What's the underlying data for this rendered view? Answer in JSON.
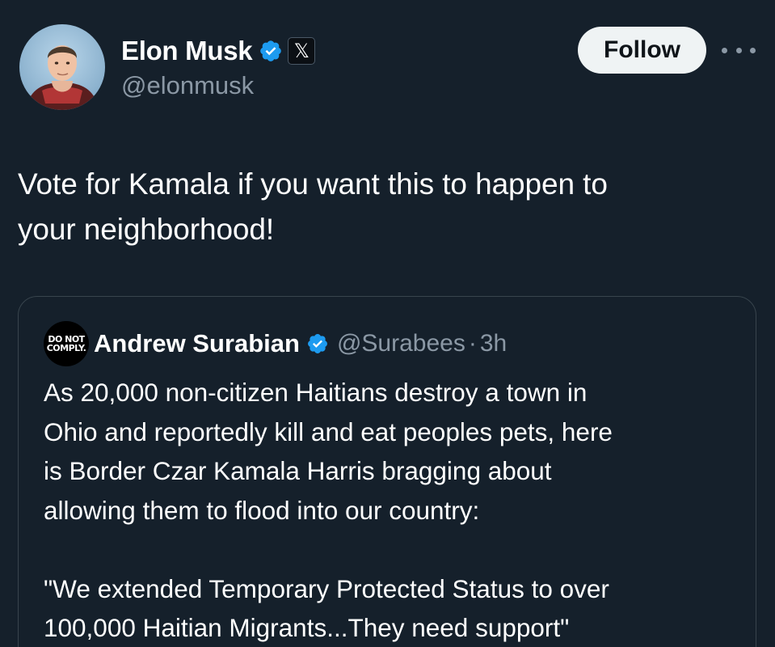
{
  "post": {
    "author": {
      "name": "Elon Musk",
      "handle": "@elonmusk",
      "verified_icon": "verified-badge-icon",
      "affiliation_icon": "x-logo-icon",
      "affiliation_glyph": "𝕏"
    },
    "follow_label": "Follow",
    "more_icon": "more-options-icon",
    "text": "Vote for Kamala if you want this to happen to\nyour neighborhood!"
  },
  "quoted_post": {
    "author": {
      "avatar_line1": "DO NOT",
      "avatar_line2": "COMPLY.",
      "name": "Andrew Surabian",
      "handle": "@Surabees",
      "separator": "·",
      "time": "3h",
      "verified_icon": "verified-badge-icon"
    },
    "text": "As 20,000 non-citizen Haitians destroy a town in\nOhio and reportedly kill and eat peoples pets, here\nis Border Czar Kamala Harris bragging about\nallowing them to flood into our country:\n\n\"We extended Temporary Protected Status to over\n100,000 Haitian Migrants...They need support\""
  },
  "colors": {
    "background": "#15202b",
    "text_primary": "#ffffff",
    "text_secondary": "#8b98a5",
    "verified_blue": "#1d9bf0",
    "follow_bg": "#eff3f4",
    "border": "#38444d"
  }
}
